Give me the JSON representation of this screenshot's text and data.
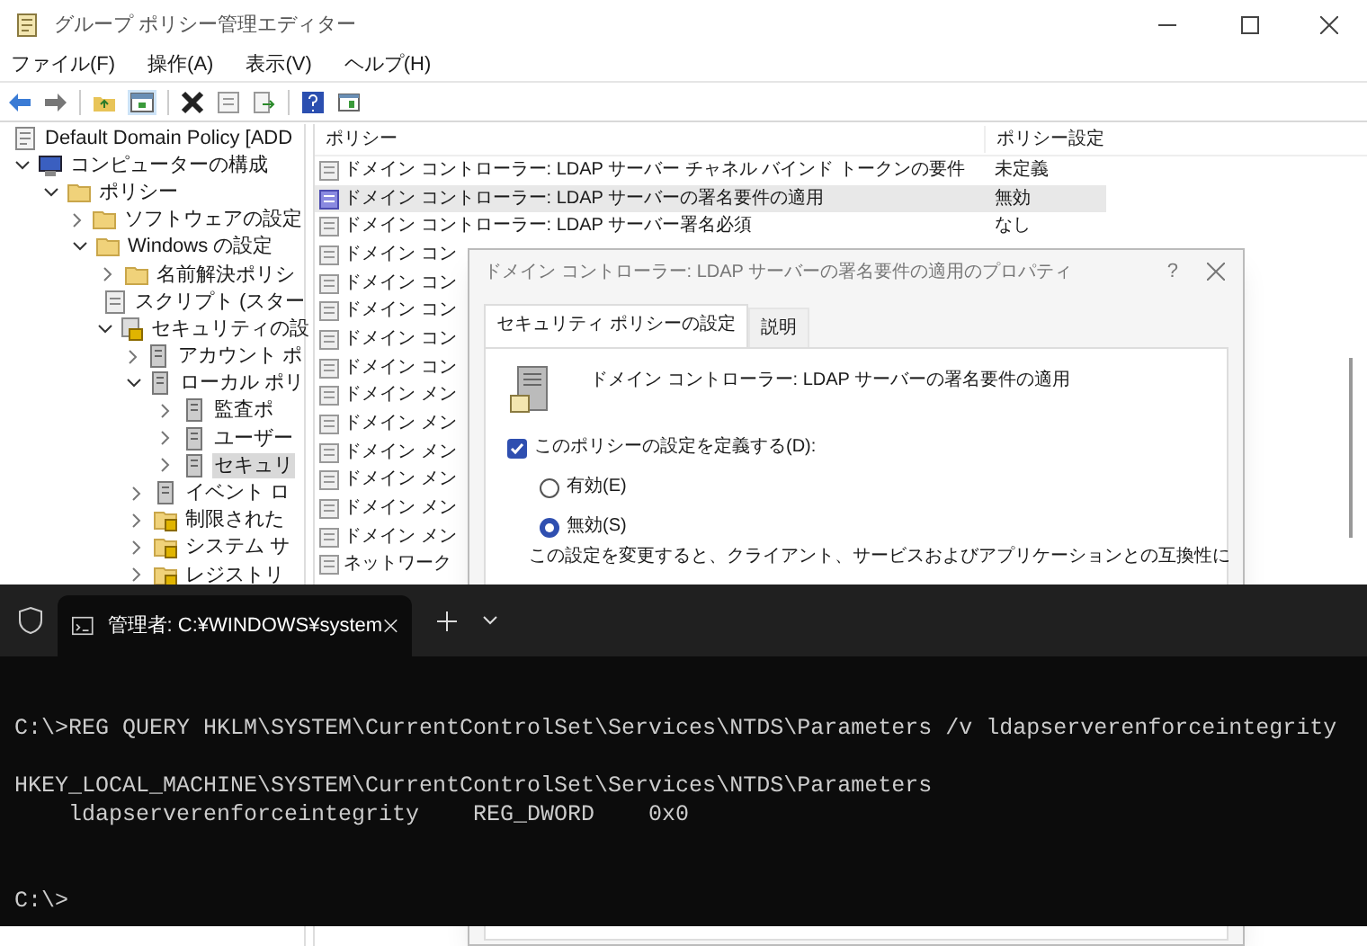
{
  "window": {
    "title": "グループ ポリシー管理エディター"
  },
  "menu": [
    "ファイル(F)",
    "操作(A)",
    "表示(V)",
    "ヘルプ(H)"
  ],
  "tree": [
    {
      "label": "Default Domain Policy [ADD",
      "kind": "policy",
      "selected": false,
      "children": [
        {
          "label": "コンピューターの構成",
          "kind": "computer",
          "expanded": true,
          "selected": false,
          "children": [
            {
              "label": "ポリシー",
              "kind": "folder",
              "expanded": true,
              "selected": false,
              "children": [
                {
                  "label": "ソフトウェアの設定",
                  "kind": "folder",
                  "expanded": false,
                  "selected": false
                },
                {
                  "label": "Windows の設定",
                  "kind": "folder",
                  "expanded": true,
                  "selected": false,
                  "children": [
                    {
                      "label": "名前解決ポリシ",
                      "kind": "folder",
                      "expanded": false,
                      "selected": false
                    },
                    {
                      "label": "スクリプト (スター",
                      "kind": "script",
                      "selected": false
                    },
                    {
                      "label": "セキュリティの設",
                      "kind": "secure",
                      "expanded": true,
                      "selected": false,
                      "children": [
                        {
                          "label": "アカウント ポ",
                          "kind": "setting",
                          "expanded": false,
                          "selected": false
                        },
                        {
                          "label": "ローカル ポリ",
                          "kind": "setting",
                          "expanded": true,
                          "selected": false,
                          "children": [
                            {
                              "label": "監査ポ",
                              "kind": "setting",
                              "expanded": false,
                              "selected": false
                            },
                            {
                              "label": "ユーザー",
                              "kind": "setting",
                              "expanded": false,
                              "selected": false
                            },
                            {
                              "label": "セキュリ",
                              "kind": "setting",
                              "expanded": false,
                              "selected": true
                            }
                          ]
                        },
                        {
                          "label": "イベント ロ",
                          "kind": "setting",
                          "expanded": false,
                          "selected": false
                        },
                        {
                          "label": "制限された",
                          "kind": "lockfolder",
                          "expanded": false,
                          "selected": false
                        },
                        {
                          "label": "システム サ",
                          "kind": "lockfolder",
                          "expanded": false,
                          "selected": false
                        },
                        {
                          "label": "レジストリ",
                          "kind": "lockfolder",
                          "expanded": false,
                          "selected": false
                        }
                      ]
                    }
                  ]
                }
              ]
            }
          ]
        }
      ]
    }
  ],
  "list": {
    "columns": [
      "ポリシー",
      "ポリシー設定"
    ],
    "rows": [
      {
        "name": "ドメイン コントローラー: LDAP サーバー チャネル バインド トークンの要件",
        "setting": "未定義",
        "selected": false
      },
      {
        "name": "ドメイン コントローラー: LDAP サーバーの署名要件の適用",
        "setting": "無効",
        "selected": true
      },
      {
        "name": "ドメイン コントローラー: LDAP サーバー署名必須",
        "setting": "なし",
        "selected": false
      },
      {
        "name": "ドメイン コン",
        "selected": false
      },
      {
        "name": "ドメイン コン",
        "selected": false
      },
      {
        "name": "ドメイン コン",
        "selected": false
      },
      {
        "name": "ドメイン コン",
        "selected": false
      },
      {
        "name": "ドメイン コン",
        "selected": false
      },
      {
        "name": "ドメイン メン",
        "selected": false
      },
      {
        "name": "ドメイン メン",
        "selected": false
      },
      {
        "name": "ドメイン メン",
        "selected": false
      },
      {
        "name": "ドメイン メン",
        "selected": false
      },
      {
        "name": "ドメイン メン",
        "selected": false
      },
      {
        "name": "ドメイン メン",
        "selected": false
      },
      {
        "name": "ネットワーク",
        "selected": false
      }
    ]
  },
  "dialog": {
    "title": "ドメイン コントローラー: LDAP サーバーの署名要件の適用のプロパティ",
    "help": "?",
    "tabs": [
      {
        "label": "セキュリティ ポリシーの設定",
        "selected": true
      },
      {
        "label": "説明",
        "selected": false
      }
    ],
    "policy_name": "ドメイン コントローラー: LDAP サーバーの署名要件の適用",
    "define": {
      "label": "このポリシーの設定を定義する(D):",
      "checked": true
    },
    "options": [
      {
        "label": "有効(E)",
        "selected": false
      },
      {
        "label": "無効(S)",
        "selected": true
      }
    ],
    "warning": "この設定を変更すると、クライアント、サービスおよびアプリケーションとの互換性に"
  },
  "terminal": {
    "tab_title": "管理者: C:¥WINDOWS¥system",
    "blocks": [
      {
        "kind": "output",
        "lines": [
          "C:\\>REG QUERY HKLM\\SYSTEM\\CurrentControlSet\\Services\\NTDS\\Parameters /v ldapserverenforceintegrity"
        ]
      },
      {
        "kind": "output",
        "lines": [
          "HKEY_LOCAL_MACHINE\\SYSTEM\\CurrentControlSet\\Services\\NTDS\\Parameters",
          "    ldapserverenforceintegrity    REG_DWORD    0x0"
        ]
      },
      {
        "kind": "prompt",
        "lines": [
          "C:\\>"
        ]
      }
    ]
  }
}
